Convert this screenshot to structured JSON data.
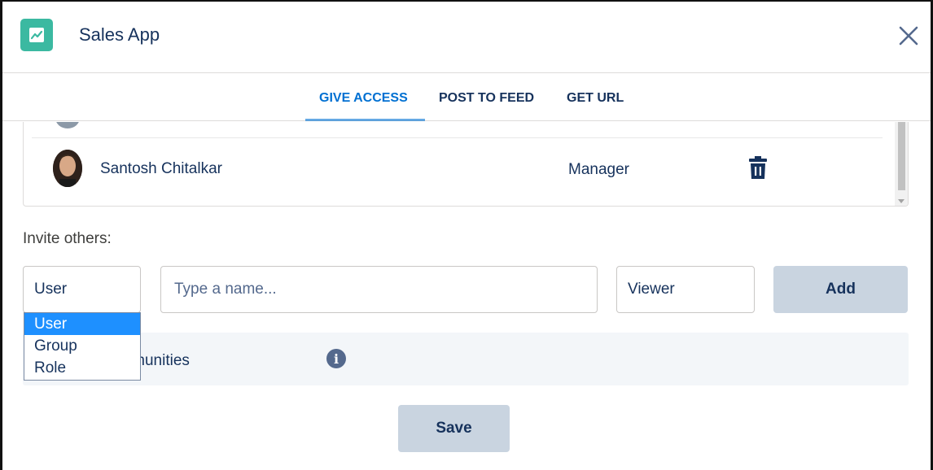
{
  "app": {
    "title": "Sales App",
    "icon": "trend-chart-icon",
    "icon_color": "#3bb9a1"
  },
  "header": {
    "close_icon": "close-icon"
  },
  "tabs": [
    {
      "label": "GIVE ACCESS",
      "active": true
    },
    {
      "label": "POST TO FEED",
      "active": false
    },
    {
      "label": "GET URL",
      "active": false
    }
  ],
  "members": [
    {
      "name": "Santosh Chitalkar",
      "role": "Manager",
      "avatar": "profile-photo",
      "action_icon": "trash-icon"
    }
  ],
  "invite": {
    "label": "Invite others:",
    "type_value": "User",
    "type_options": [
      "User",
      "Group",
      "Role"
    ],
    "type_options_selected": "User",
    "name_placeholder": "Type a name...",
    "access_value": "Viewer",
    "add_label": "Add"
  },
  "communities": {
    "text": "ring with Communities",
    "icon": "info-icon"
  },
  "footer": {
    "save_label": "Save"
  },
  "colors": {
    "accent": "#0070d2",
    "button_bg": "#c9d4e0",
    "text": "#16325c",
    "dropdown_highlight": "#1e90ff"
  }
}
